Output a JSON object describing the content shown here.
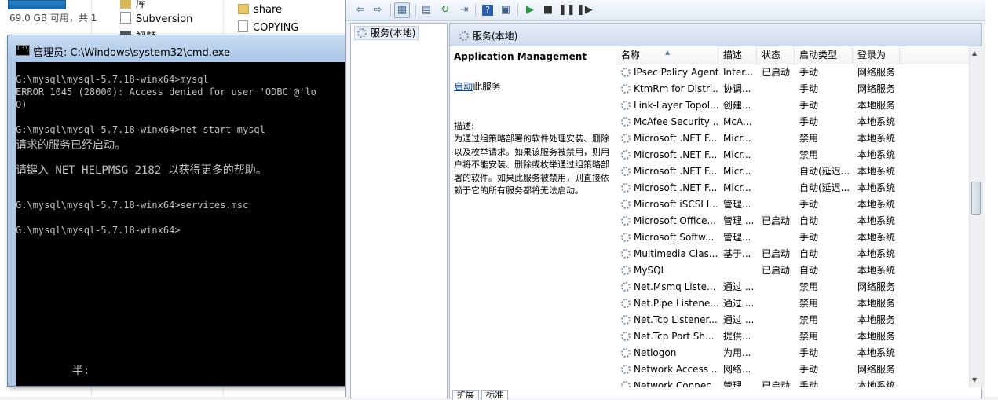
{
  "explorer": {
    "disk_free": "69.0 GB 可用，共 1",
    "nav_items": [
      "库",
      "Subversion",
      "视频"
    ],
    "files": [
      "share",
      "COPYING"
    ]
  },
  "cmd": {
    "title": "管理员: C:\\Windows\\system32\\cmd.exe",
    "lines": [
      "G:\\mysql\\mysql-5.7.18-winx64>mysql",
      "ERROR 1045 (28000): Access denied for user 'ODBC'@'lo",
      "O)",
      "",
      "G:\\mysql\\mysql-5.7.18-winx64>net start mysql",
      "请求的服务已经启动。",
      "",
      "请键入 NET HELPMSG 2182 以获得更多的帮助。",
      "",
      "",
      "G:\\mysql\\mysql-5.7.18-winx64>services.msc",
      "",
      "G:\\mysql\\mysql-5.7.18-winx64>"
    ],
    "ime_text": "半:"
  },
  "services": {
    "tree_item": "服务(本地)",
    "header_title": "服务(本地)",
    "selected_service": "Application Management",
    "action_link": "启动",
    "action_suffix": "此服务",
    "desc_label": "描述:",
    "description": "为通过组策略部署的软件处理安装、删除以及枚举请求。如果该服务被禁用，则用户将不能安装、删除或枚举通过组策略部署的软件。如果此服务被禁用，则直接依赖于它的所有服务都将无法启动。",
    "columns": [
      "名称",
      "描述",
      "状态",
      "启动类型",
      "登录为"
    ],
    "rows": [
      [
        "IPsec Policy Agent",
        "Inter...",
        "已启动",
        "手动",
        "网络服务"
      ],
      [
        "KtmRm for Distri...",
        "协调...",
        "",
        "手动",
        "网络服务"
      ],
      [
        "Link-Layer Topol...",
        "创建...",
        "",
        "手动",
        "本地服务"
      ],
      [
        "McAfee Security ...",
        "McA...",
        "",
        "手动",
        "本地系统"
      ],
      [
        "Microsoft .NET F...",
        "Micr...",
        "",
        "禁用",
        "本地系统"
      ],
      [
        "Microsoft .NET F...",
        "Micr...",
        "",
        "禁用",
        "本地系统"
      ],
      [
        "Microsoft .NET F...",
        "Micr...",
        "",
        "自动(延迟...",
        "本地系统"
      ],
      [
        "Microsoft .NET F...",
        "Micr...",
        "",
        "自动(延迟...",
        "本地系统"
      ],
      [
        "Microsoft iSCSI I...",
        "管理...",
        "",
        "手动",
        "本地系统"
      ],
      [
        "Microsoft Office...",
        "管理 ...",
        "已启动",
        "自动",
        "本地系统"
      ],
      [
        "Microsoft Softw...",
        "管理...",
        "",
        "手动",
        "本地系统"
      ],
      [
        "Multimedia Clas...",
        "基于...",
        "已启动",
        "自动",
        "本地系统"
      ],
      [
        "MySQL",
        "",
        "已启动",
        "自动",
        "本地系统"
      ],
      [
        "Net.Msmq Liste...",
        "通过 ...",
        "",
        "禁用",
        "网络服务"
      ],
      [
        "Net.Pipe Listene...",
        "通过 ...",
        "",
        "禁用",
        "本地服务"
      ],
      [
        "Net.Tcp Listener...",
        "通过 ...",
        "",
        "禁用",
        "本地服务"
      ],
      [
        "Net.Tcp Port Sh...",
        "提供...",
        "",
        "禁用",
        "本地服务"
      ],
      [
        "Netlogon",
        "为用...",
        "",
        "手动",
        "本地系统"
      ],
      [
        "Network Access ...",
        "网络...",
        "",
        "手动",
        "网络服务"
      ],
      [
        "Network Connec...",
        "管理...",
        "已启动",
        "手动",
        "本地系统"
      ]
    ],
    "tabs": [
      "扩展",
      "标准"
    ]
  },
  "colors": {
    "console_bg": "#000000",
    "console_text": "#c0c0c0",
    "link": "#0645ad",
    "window_frame": "#aec6e2"
  }
}
